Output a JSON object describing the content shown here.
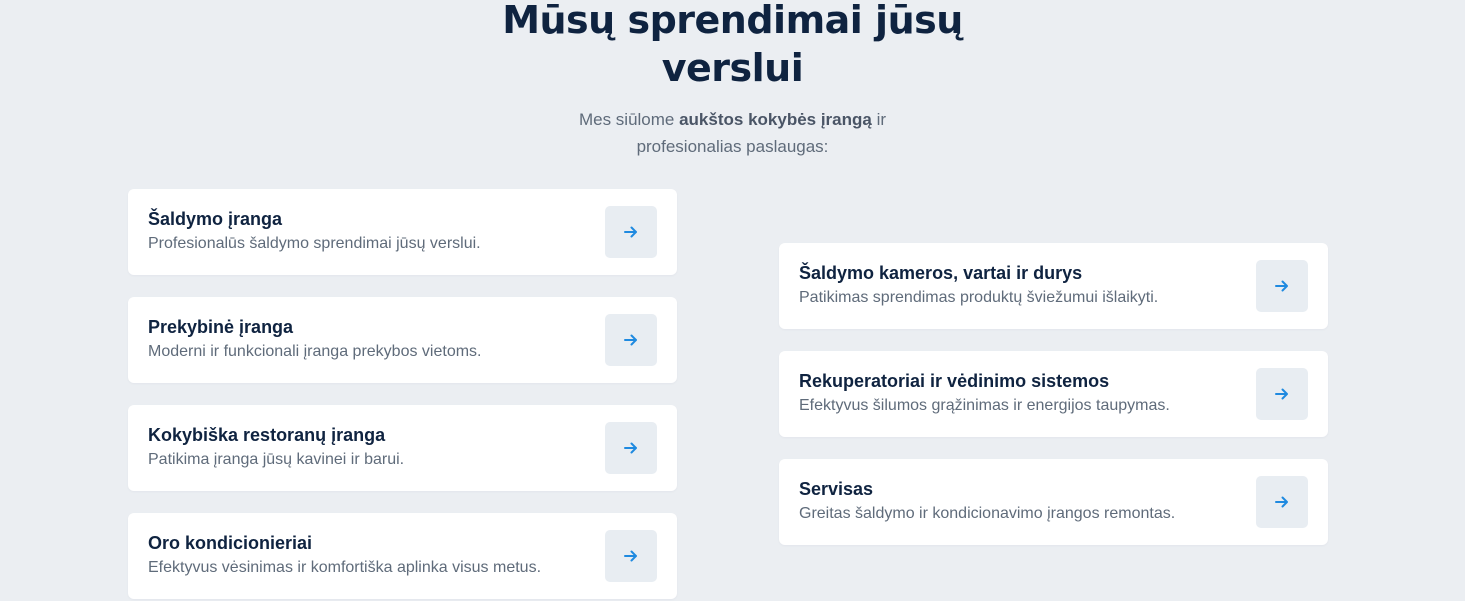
{
  "header": {
    "title_line1": "Mūsų sprendimai jūsų",
    "title_line2": "verslui",
    "subtitle_prefix": "Mes siūlome ",
    "subtitle_bold": "aukštos kokybės įrangą",
    "subtitle_suffix": " ir",
    "subtitle_line2": "profesionalias paslaugas:"
  },
  "colors": {
    "background": "#ebeef2",
    "card": "#ffffff",
    "title": "#0f2340",
    "text_muted": "#5f6b7a",
    "arrow": "#1f8ae0",
    "arrow_bg": "#e8edf2"
  },
  "cards_left": [
    {
      "title": "Šaldymo įranga",
      "description": "Profesionalūs šaldymo sprendimai jūsų verslui.",
      "icon": "arrow-right-icon"
    },
    {
      "title": "Prekybinė įranga",
      "description": "Moderni ir funkcionali įranga prekybos vietoms.",
      "icon": "arrow-right-icon"
    },
    {
      "title": "Kokybiška restoranų įranga",
      "description": "Patikima įranga jūsų kavinei ir barui.",
      "icon": "arrow-right-icon"
    },
    {
      "title": "Oro kondicionieriai",
      "description": "Efektyvus vėsinimas ir komfortiška aplinka visus metus.",
      "icon": "arrow-right-icon"
    }
  ],
  "cards_right": [
    {
      "title": "Šaldymo kameros, vartai ir durys",
      "description": "Patikimas sprendimas produktų šviežumui išlaikyti.",
      "icon": "arrow-right-icon"
    },
    {
      "title": "Rekuperatoriai ir vėdinimo sistemos",
      "description": "Efektyvus šilumos grąžinimas ir energijos taupymas.",
      "icon": "arrow-right-icon"
    },
    {
      "title": "Servisas",
      "description": "Greitas šaldymo ir kondicionavimo įrangos remontas.",
      "icon": "arrow-right-icon"
    }
  ]
}
